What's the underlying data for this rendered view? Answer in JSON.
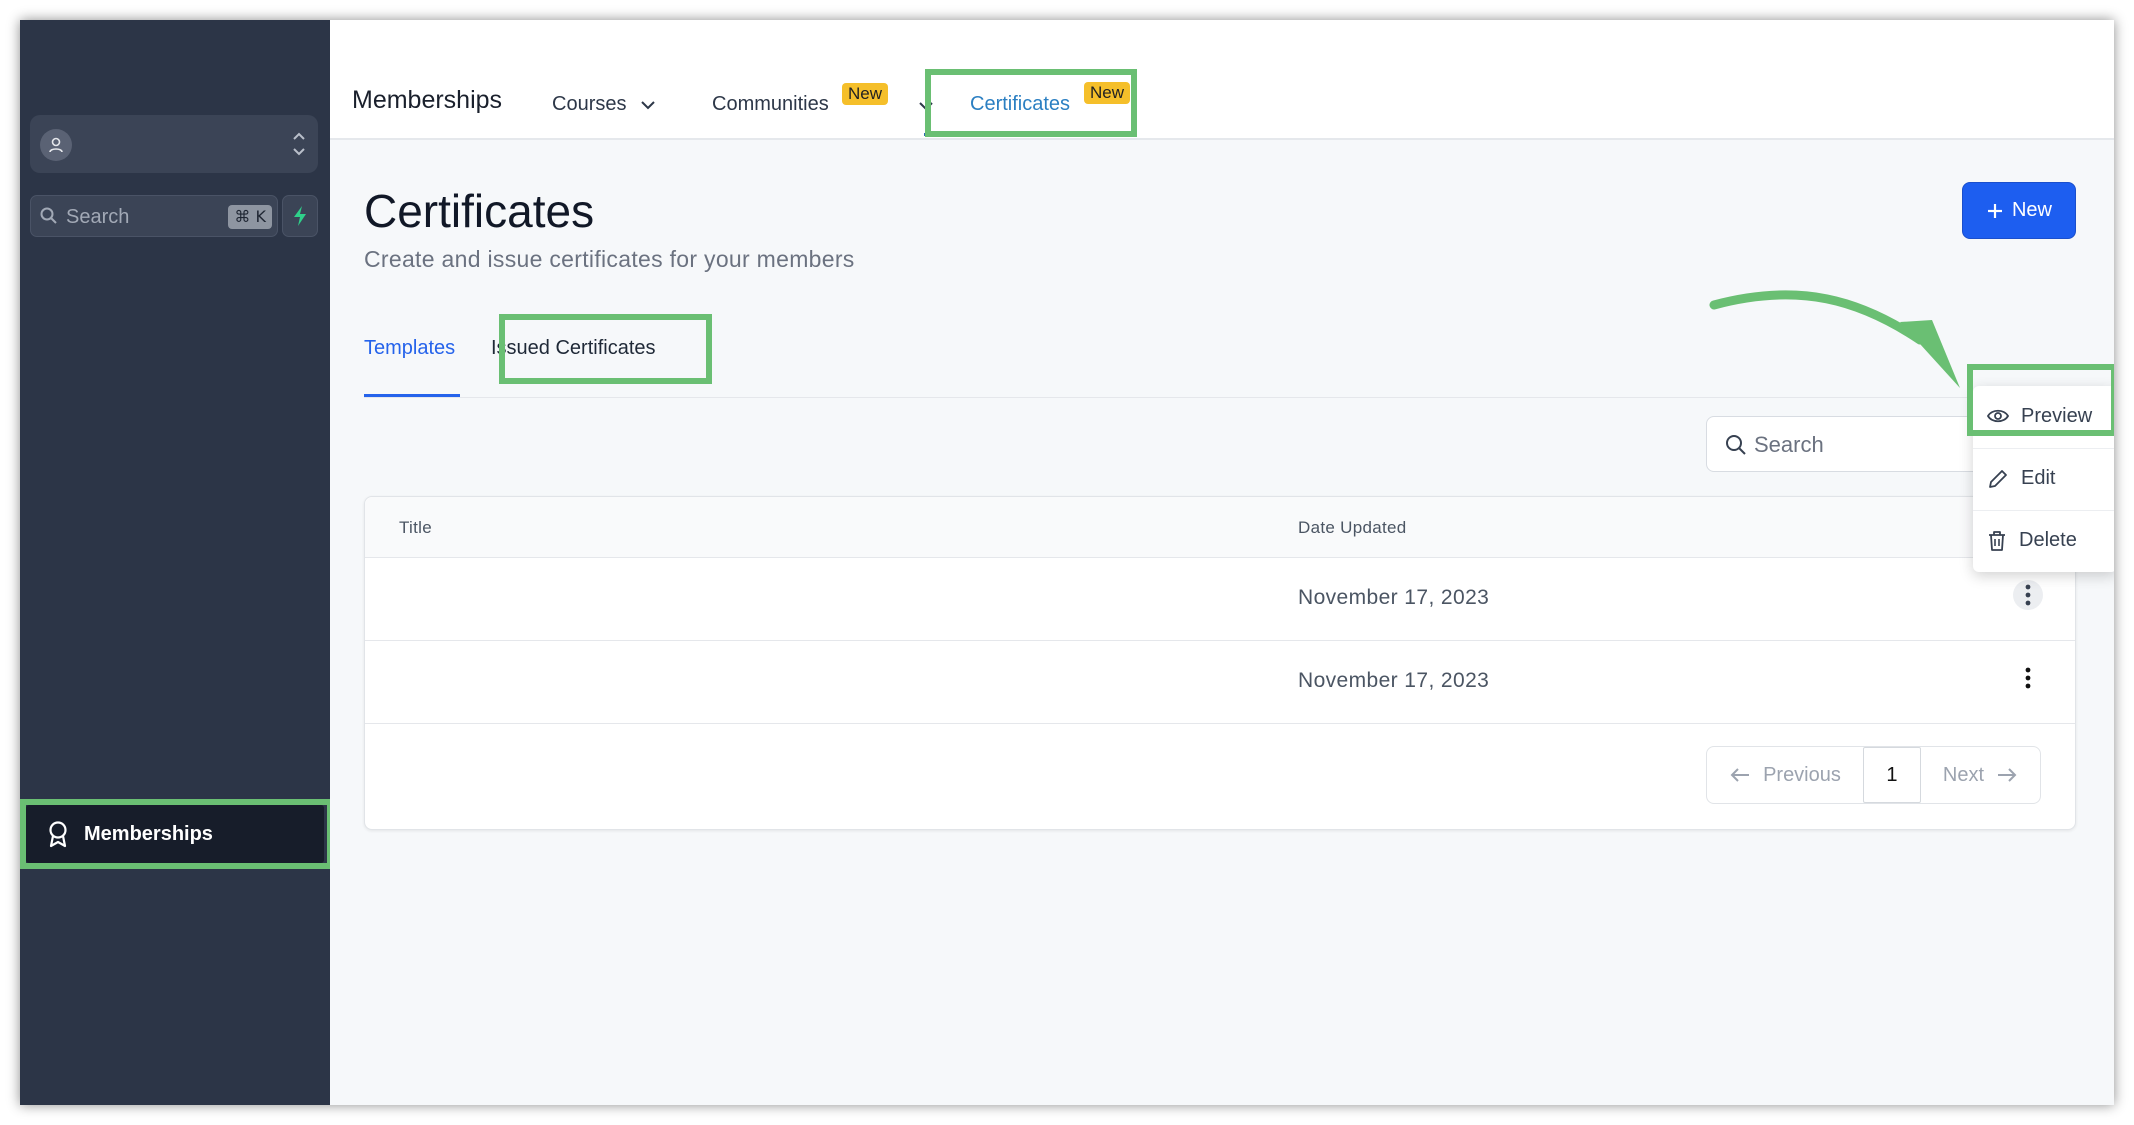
{
  "sidebar": {
    "search_placeholder": "Search",
    "shortcut": "⌘ K",
    "nav_item": "Memberships"
  },
  "topnav": {
    "brand": "Memberships",
    "items": [
      {
        "label": "Courses"
      },
      {
        "label": "Communities",
        "badge": "New"
      },
      {
        "label": "Certificates",
        "badge": "New"
      }
    ]
  },
  "page": {
    "title": "Certificates",
    "subtitle": "Create and issue certificates for your members",
    "new_button": "New"
  },
  "tabs": [
    {
      "label": "Templates"
    },
    {
      "label": "Issued Certificates"
    }
  ],
  "table": {
    "search_placeholder": "Search",
    "columns": [
      "Title",
      "Date Updated"
    ],
    "rows": [
      {
        "title": "",
        "date": "November 17, 2023"
      },
      {
        "title": "",
        "date": "November 17, 2023"
      }
    ],
    "pagination": {
      "previous": "Previous",
      "page": "1",
      "next": "Next"
    }
  },
  "menu": {
    "items": [
      {
        "label": "Preview",
        "icon": "eye-icon"
      },
      {
        "label": "Edit",
        "icon": "pencil-icon"
      },
      {
        "label": "Delete",
        "icon": "trash-icon"
      }
    ]
  },
  "colors": {
    "sidebar_bg": "#2c3547",
    "accent": "#1d5ef0",
    "badge": "#f5bf2a",
    "highlight": "#6abf73"
  }
}
